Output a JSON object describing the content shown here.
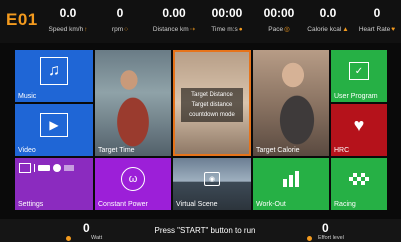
{
  "brand": {
    "logo_text": "E01"
  },
  "stats": [
    {
      "value": "0.0",
      "label": "Speed km/h"
    },
    {
      "value": "0",
      "label": "rpm"
    },
    {
      "value": "0.00",
      "label": "Distance km"
    },
    {
      "value": "00:00",
      "label": "Time m:s"
    },
    {
      "value": "00:00",
      "label": "Pace"
    },
    {
      "value": "0.0",
      "label": "Calorie kcal"
    },
    {
      "value": "0",
      "label": "Heart Rate"
    }
  ],
  "tiles": {
    "music": {
      "label": "Music",
      "color": "#1f66d6",
      "icon": "music-note-icon"
    },
    "video": {
      "label": "Video",
      "color": "#1f66d6",
      "icon": "play-icon"
    },
    "target_time": {
      "label": "Target Time"
    },
    "target_distance": {
      "lines": [
        "Target Distance",
        "Target distance",
        "countdown mode"
      ]
    },
    "target_calorie": {
      "label": "Target Calorie"
    },
    "user_program": {
      "label": "User Program",
      "color": "#26b045",
      "icon": "edit-icon"
    },
    "hrc": {
      "label": "HRC",
      "color": "#b5121b",
      "icon": "heart-pulse-icon"
    },
    "settings": {
      "label": "Settings",
      "color": "#8b2bbf",
      "icon": "settings-icons"
    },
    "constant_power": {
      "label": "Constant Power",
      "color": "#9c1fd8",
      "icon": "power-icon"
    },
    "virtual_scene": {
      "label": "Virtual Scene"
    },
    "work_out": {
      "label": "Work-Out",
      "color": "#26b045",
      "icon": "bar-chart-icon"
    },
    "racing": {
      "label": "Racing",
      "color": "#26b045",
      "icon": "checkered-flag-icon"
    }
  },
  "bottom": {
    "watt_value": "0",
    "watt_label": "Watt",
    "message": "Press \"START\" button to run",
    "effort_value": "0",
    "effort_label": "Effort level"
  }
}
